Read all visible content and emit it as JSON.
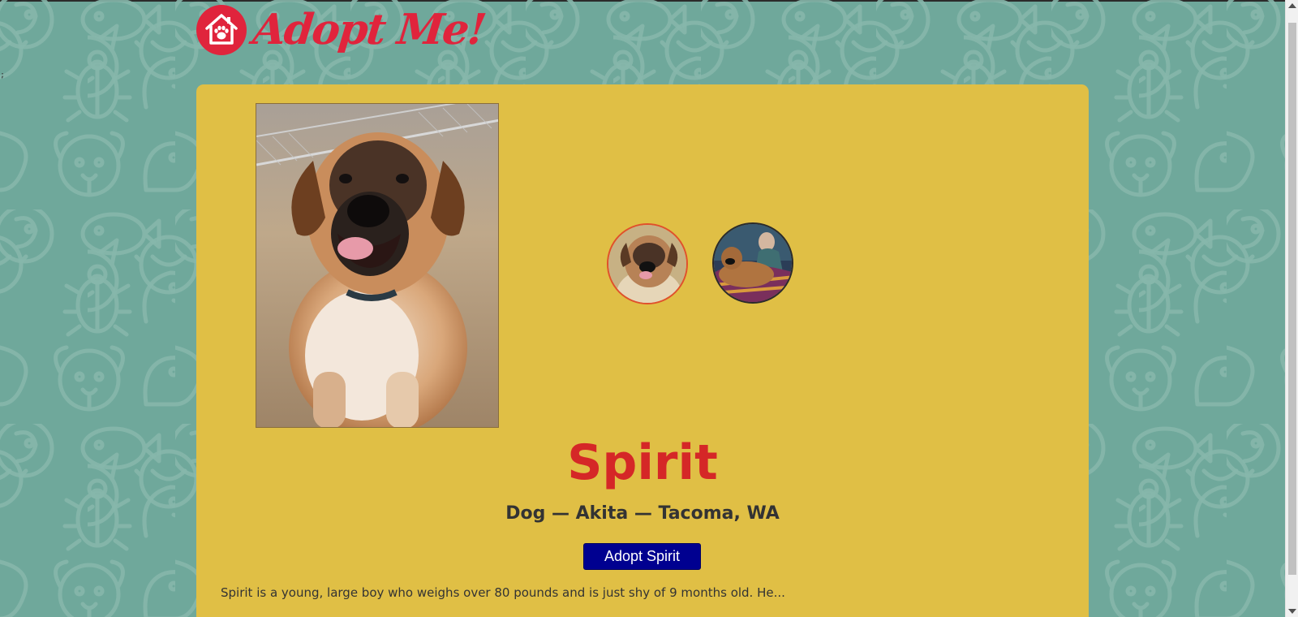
{
  "app": {
    "brand_title": "Adopt Me!",
    "stray_text": ";"
  },
  "pet": {
    "name": "Spirit",
    "meta": "Dog — Akita — Tacoma, WA",
    "adopt_label": "Adopt Spirit",
    "description": "Spirit is a young, large boy who weighs over 80 pounds and is just shy of 9 months old. He..."
  },
  "icons": {
    "logo": "house-paw-icon",
    "pattern": [
      "dog-icon",
      "cat-icon",
      "fish-icon",
      "bird-icon",
      "beetle-icon",
      "chicken-icon",
      "reptile-icon"
    ]
  },
  "colors": {
    "background": "#6fa89b",
    "card": "#e0bf45",
    "brand": "#e0243c",
    "name": "#d52727",
    "button": "#000090"
  }
}
